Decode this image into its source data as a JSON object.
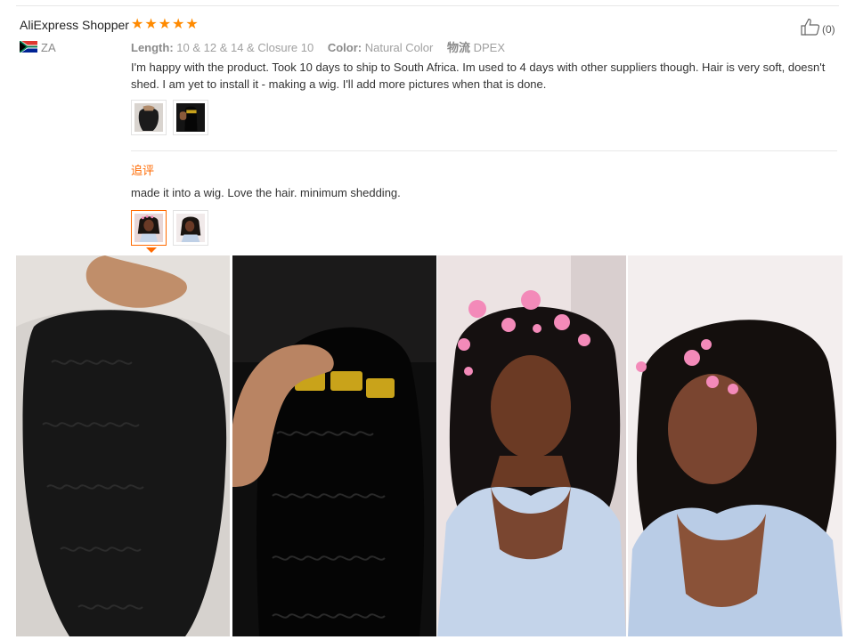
{
  "review": {
    "user_name": "AliExpress Shopper",
    "rating": 5,
    "country": "ZA",
    "like_count": "(0)",
    "attributes": [
      {
        "key": "Length:",
        "value": "10 & 12 & 14 & Closure 10"
      },
      {
        "key": "Color:",
        "value": "Natural Color"
      },
      {
        "key": "物流",
        "value": "DPEX"
      }
    ],
    "text": "I'm happy with the product. Took 10 days to ship to South Africa. Im used to 4 days with other suppliers though. Hair is very soft, doesn't shed. I am yet to install it - making a wig. I'll add more pictures when that is done.",
    "followup": {
      "label": "追评",
      "text": "made it into a wig. Love the hair. minimum shedding."
    }
  },
  "icons": [
    "star-icon",
    "south-africa-flag-icon",
    "thumbs-up-icon"
  ],
  "colors": {
    "accent": "#ff6a00",
    "star": "#ff8a00",
    "divider": "#e8e8e8"
  }
}
